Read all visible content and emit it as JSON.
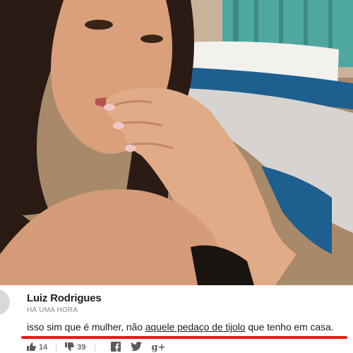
{
  "photo": {
    "description_icon": "selfie-photo"
  },
  "comment": {
    "author": "Luiz Rodrigues",
    "time": "HÁ UMA HORA",
    "text_before": "isso sim que é mulher, não ",
    "text_underlined": "aquele pedaço de tijolo",
    "text_after": " que tenho em casa.",
    "highlight_color": "#e41b17"
  },
  "actions": {
    "like_count": "14",
    "dislike_count": "39",
    "like_icon": "thumbs-up-icon",
    "dislike_icon": "thumbs-down-icon",
    "share_icons": [
      "facebook-icon",
      "twitter-icon",
      "google-plus-icon"
    ],
    "google_plus_label": "g+"
  }
}
